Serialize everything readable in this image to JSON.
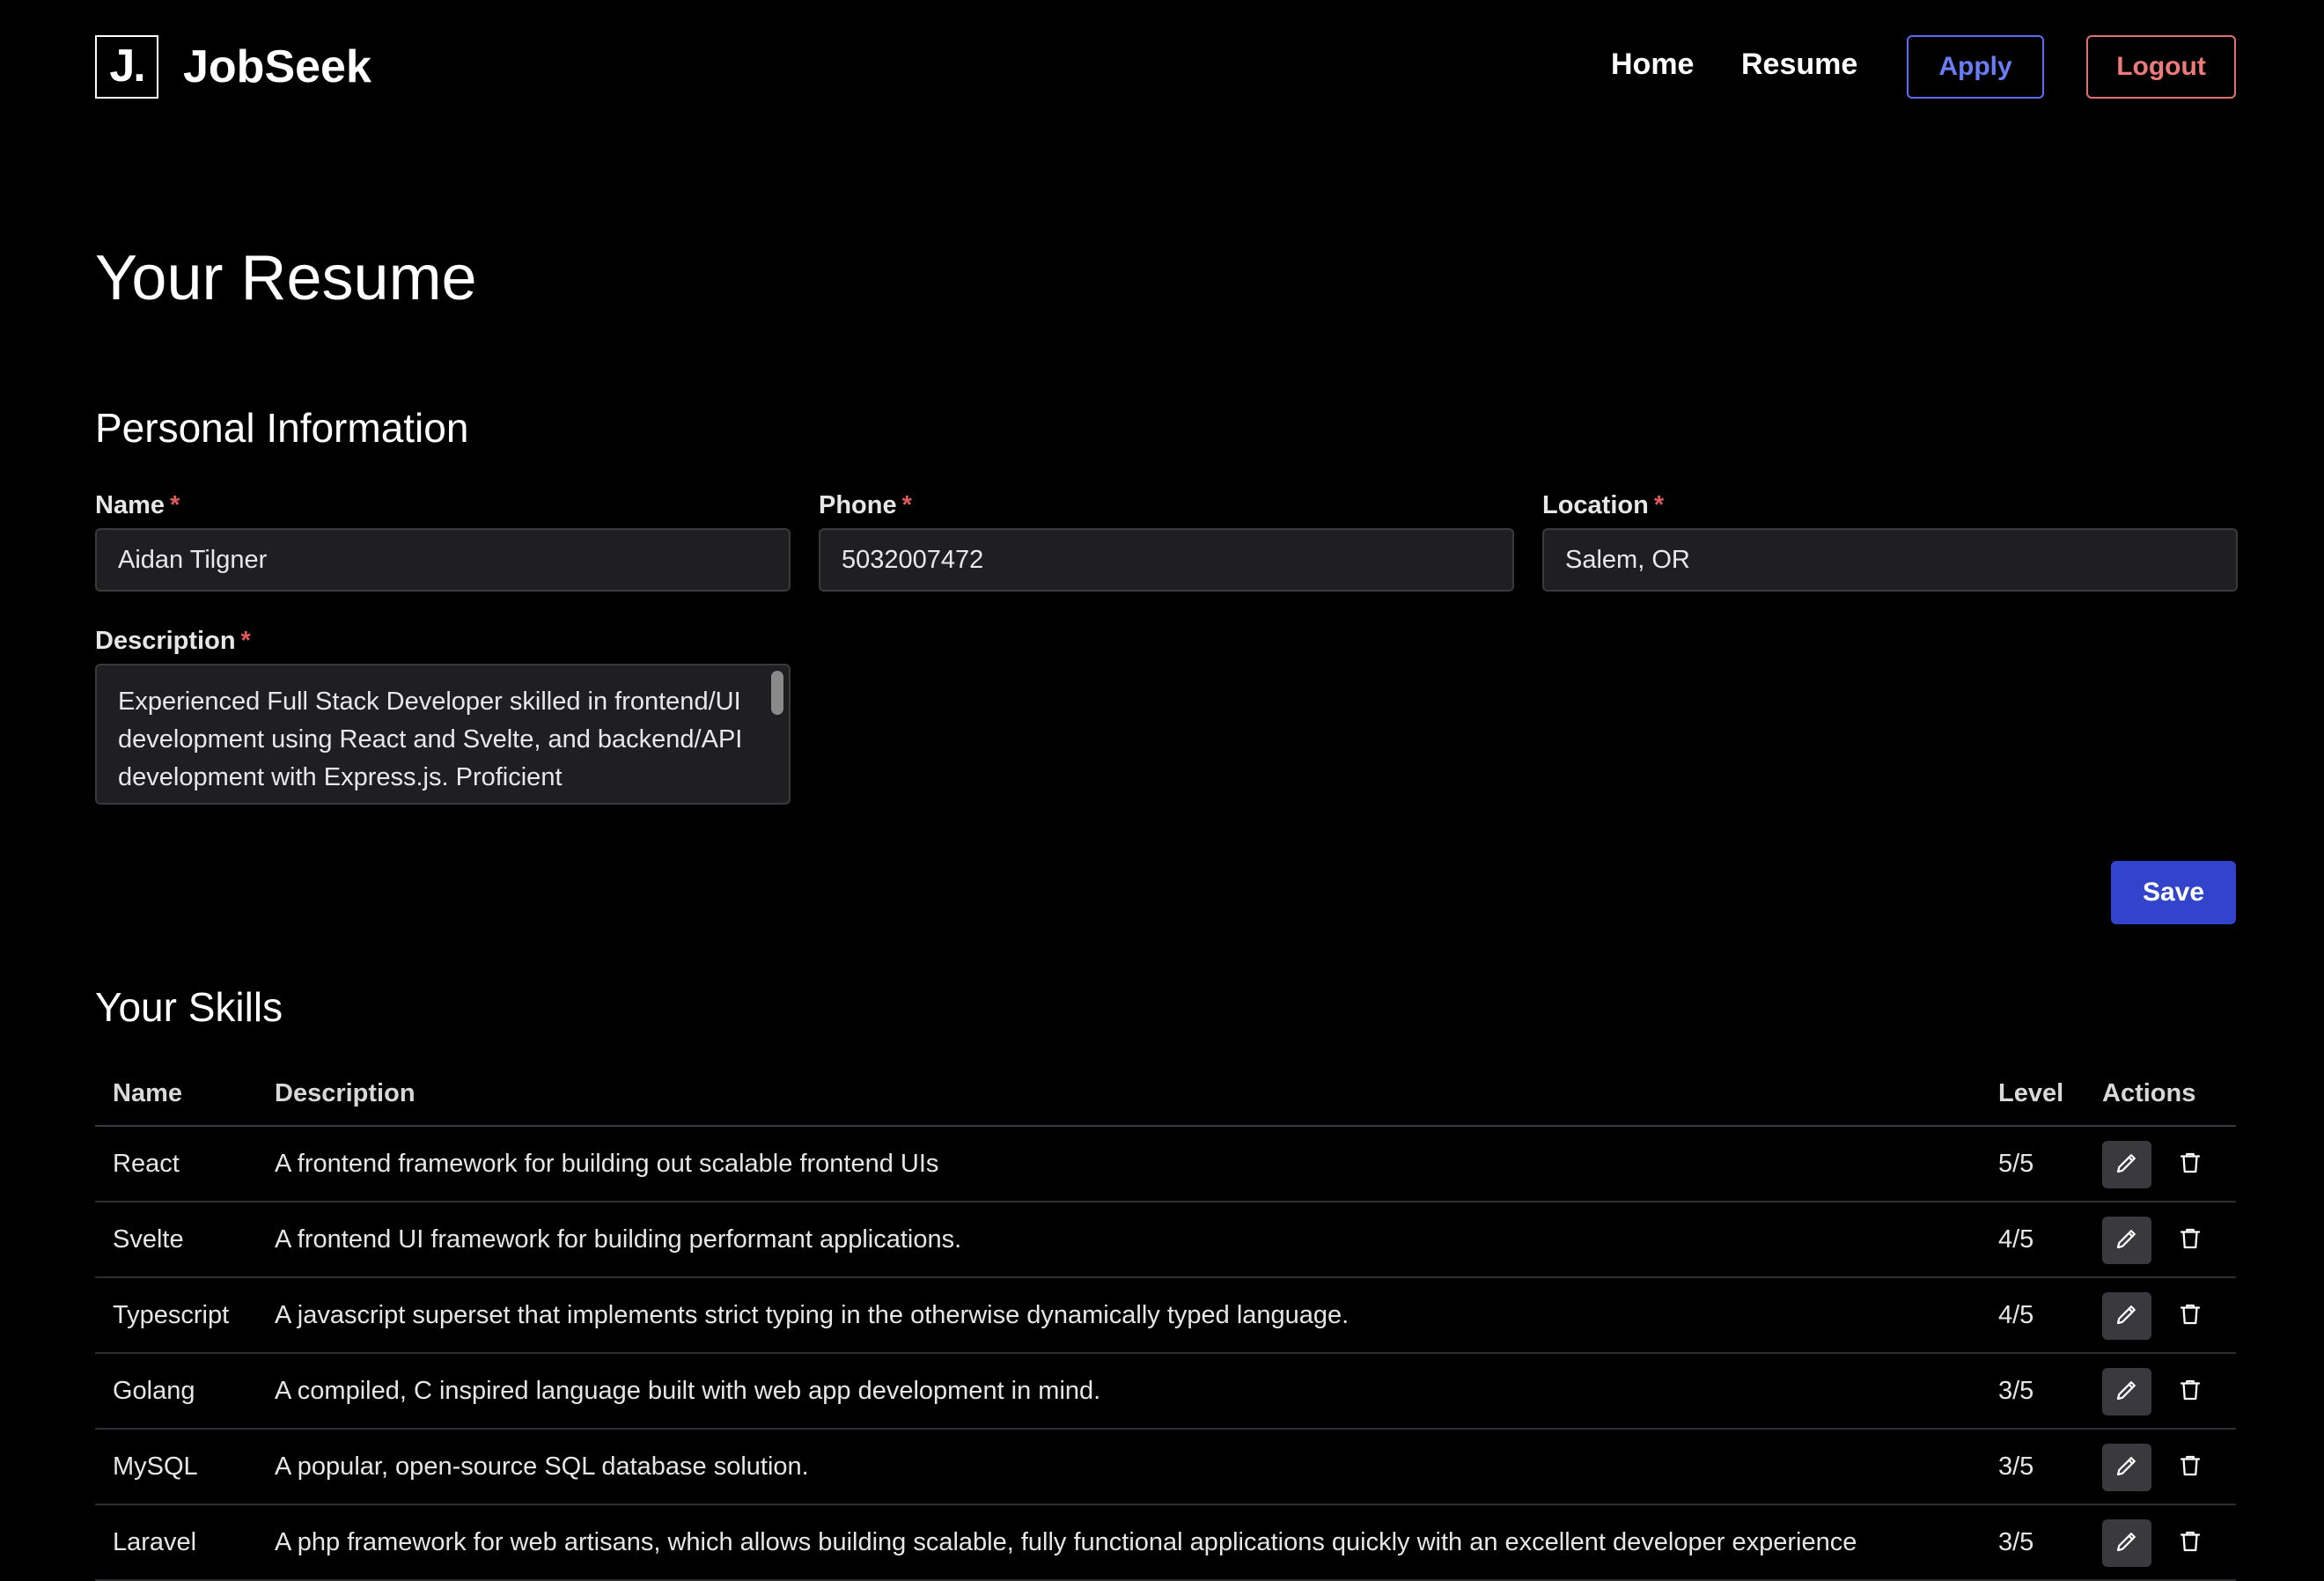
{
  "header": {
    "logo_mark": "J.",
    "brand": "JobSeek",
    "nav": {
      "home": "Home",
      "resume": "Resume"
    },
    "apply_label": "Apply",
    "logout_label": "Logout"
  },
  "page_title": "Your Resume",
  "personal": {
    "section_title": "Personal Information",
    "required_mark": "*",
    "name": {
      "label": "Name",
      "value": "Aidan Tilgner"
    },
    "phone": {
      "label": "Phone",
      "value": "5032007472"
    },
    "location": {
      "label": "Location",
      "value": "Salem, OR"
    },
    "description": {
      "label": "Description",
      "value": "Experienced Full Stack Developer skilled in frontend/UI development using React and Svelte, and backend/API development with Express.js. Proficient"
    },
    "save_label": "Save"
  },
  "skills": {
    "section_title": "Your Skills",
    "columns": {
      "name": "Name",
      "description": "Description",
      "level": "Level",
      "actions": "Actions"
    },
    "rows": [
      {
        "name": "React",
        "description": "A frontend framework for building out scalable frontend UIs",
        "level": "5/5"
      },
      {
        "name": "Svelte",
        "description": "A frontend UI framework for building performant applications.",
        "level": "4/5"
      },
      {
        "name": "Typescript",
        "description": "A javascript superset that implements strict typing in the otherwise dynamically typed language.",
        "level": "4/5"
      },
      {
        "name": "Golang",
        "description": "A compiled, C inspired language built with web app development in mind.",
        "level": "3/5"
      },
      {
        "name": "MySQL",
        "description": "A popular, open-source SQL database solution.",
        "level": "3/5"
      },
      {
        "name": "Laravel",
        "description": "A php framework for web artisans, which allows building scalable, fully functional applications quickly with an excellent developer experience",
        "level": "3/5"
      }
    ]
  },
  "icons": {
    "edit": "pencil-icon",
    "delete": "trash-icon"
  },
  "colors": {
    "background": "#000000",
    "primary": "#3344cc",
    "apply": "#5b6cf0",
    "logout": "#e07070",
    "required": "#e05a5a"
  }
}
